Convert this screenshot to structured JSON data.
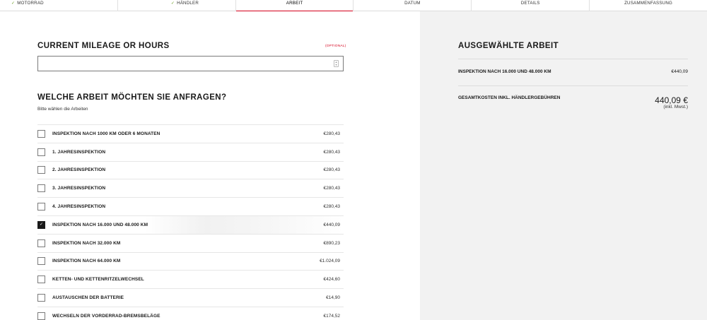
{
  "steps": [
    {
      "label": "Motorrad",
      "done": true
    },
    {
      "label": "Händler",
      "done": true
    },
    {
      "label": "Arbeit",
      "done": false
    },
    {
      "label": "Datum",
      "done": false
    },
    {
      "label": "Details",
      "done": false
    },
    {
      "label": "Zusammenfassung",
      "done": false
    }
  ],
  "mileage": {
    "title": "Current Mileage or Hours",
    "optional": "(OPTIONAL)",
    "value": ""
  },
  "work": {
    "title": "Welche Arbeit möchten Sie anfragen?",
    "subtitle": "Bitte wählen die Arbeiten",
    "items": [
      {
        "label": "Inspektion nach 1000 km oder 6 Monaten",
        "price": "€280,43",
        "checked": false
      },
      {
        "label": "1. Jahresinspektion",
        "price": "€280,43",
        "checked": false
      },
      {
        "label": "2. Jahresinspektion",
        "price": "€280,43",
        "checked": false
      },
      {
        "label": "3. Jahresinspektion",
        "price": "€280,43",
        "checked": false
      },
      {
        "label": "4. Jahresinspektion",
        "price": "€280,43",
        "checked": false
      },
      {
        "label": "Inspektion nach 16.000 und 48.000 km",
        "price": "€440,09",
        "checked": true
      },
      {
        "label": "Inspektion nach 32.000 km",
        "price": "€890,23",
        "checked": false
      },
      {
        "label": "Inspektion nach 64.000 km",
        "price": "€1.024,09",
        "checked": false
      },
      {
        "label": "Ketten- und Kettenritzelwechsel",
        "price": "€424,60",
        "checked": false
      },
      {
        "label": "Austauschen der Batterie",
        "price": "€14,90",
        "checked": false
      },
      {
        "label": "Wechseln der Vorderrad-Bremsbeläge",
        "price": "€174,52",
        "checked": false
      }
    ]
  },
  "summary": {
    "title": "Ausgewählte Arbeit",
    "item_label": "Inspektion nach 16.000 und 48.000 km",
    "item_price": "€440,09",
    "total_label": "Gesamtkosten inkl. Händlergebühren",
    "total": "440,09 €",
    "incl": "(inkl. Mwst.)"
  },
  "colors": {
    "accent": "#d5001c",
    "check": "#6a9e1f",
    "panel": "#f2f2f2"
  }
}
